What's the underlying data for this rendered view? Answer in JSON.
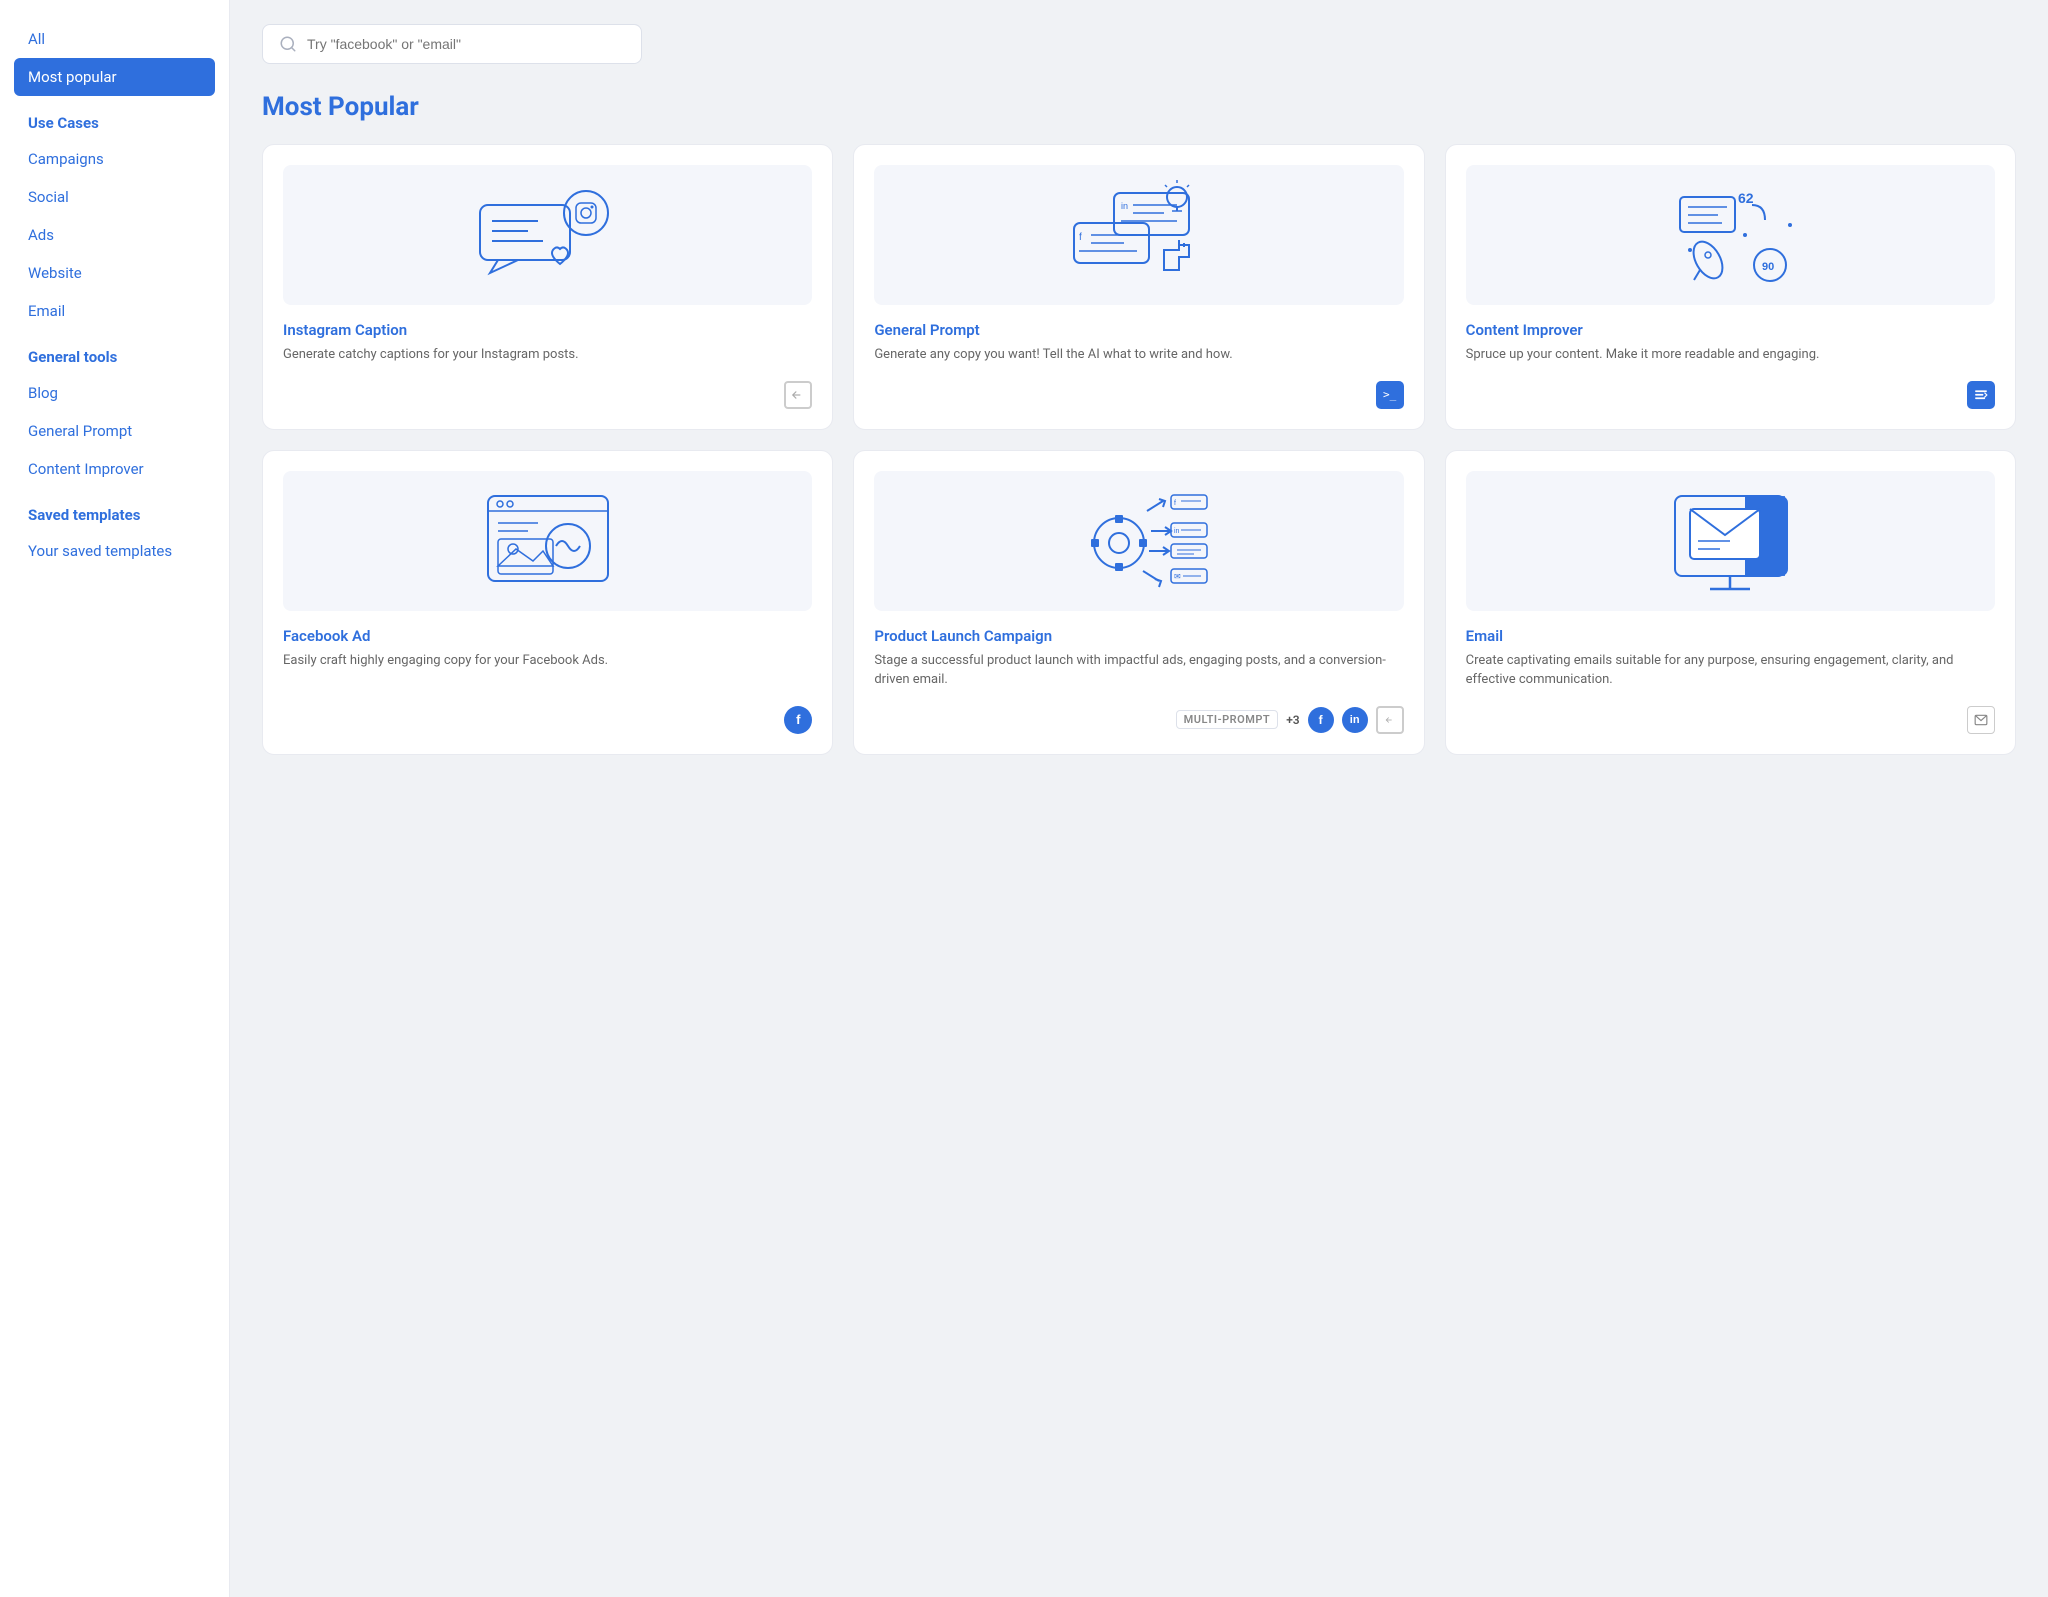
{
  "sidebar": {
    "all_label": "All",
    "most_popular_label": "Most popular",
    "use_cases_header": "Use Cases",
    "use_cases": [
      {
        "label": "Campaigns",
        "id": "campaigns"
      },
      {
        "label": "Social",
        "id": "social"
      },
      {
        "label": "Ads",
        "id": "ads"
      },
      {
        "label": "Website",
        "id": "website"
      },
      {
        "label": "Email",
        "id": "email"
      }
    ],
    "general_tools_header": "General tools",
    "general_tools": [
      {
        "label": "Blog",
        "id": "blog"
      },
      {
        "label": "General Prompt",
        "id": "general-prompt"
      },
      {
        "label": "Content Improver",
        "id": "content-improver"
      }
    ],
    "saved_templates_header": "Saved templates",
    "saved_templates": [
      {
        "label": "Your saved templates",
        "id": "your-saved-templates"
      }
    ]
  },
  "search": {
    "placeholder": "Try \"facebook\" or \"email\""
  },
  "main": {
    "section_title": "Most Popular",
    "cards": [
      {
        "id": "instagram-caption",
        "title": "Instagram Caption",
        "desc": "Generate catchy captions for your Instagram posts.",
        "icon_type": "corner-bracket",
        "row": 1
      },
      {
        "id": "general-prompt",
        "title": "General Prompt",
        "desc": "Generate any copy you want! Tell the AI what to write and how.",
        "icon_type": "terminal",
        "row": 1
      },
      {
        "id": "content-improver",
        "title": "Content Improver",
        "desc": "Spruce up your content. Make it more readable and engaging.",
        "icon_type": "list-improve",
        "row": 1
      },
      {
        "id": "facebook-ad",
        "title": "Facebook Ad",
        "desc": "Easily craft highly engaging copy for your Facebook Ads.",
        "icon_type": "facebook",
        "row": 2
      },
      {
        "id": "product-launch",
        "title": "Product Launch Campaign",
        "desc": "Stage a successful product launch with impactful ads, engaging posts, and a conversion-driven email.",
        "icon_type": "multi",
        "row": 2,
        "multi_prompt": true,
        "plus_count": "+3"
      },
      {
        "id": "email",
        "title": "Email",
        "desc": "Create captivating emails suitable for any purpose, ensuring engagement, clarity, and effective communication.",
        "icon_type": "email",
        "row": 2
      }
    ]
  }
}
